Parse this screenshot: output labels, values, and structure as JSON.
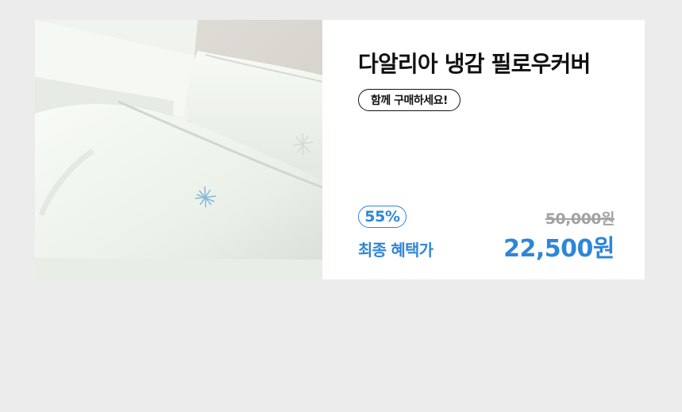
{
  "product": {
    "name": "다알리아 냉감 필로우커버",
    "buy_together_label": "함께 구매하세요!",
    "discount_rate": "55%",
    "final_price_label": "최종 혜택가",
    "original_price": "50,000원",
    "final_price": "22,500원"
  },
  "colors": {
    "accent": "#2f86d9",
    "muted": "#a3a3a3",
    "background": "#ececec",
    "card": "#ffffff"
  }
}
